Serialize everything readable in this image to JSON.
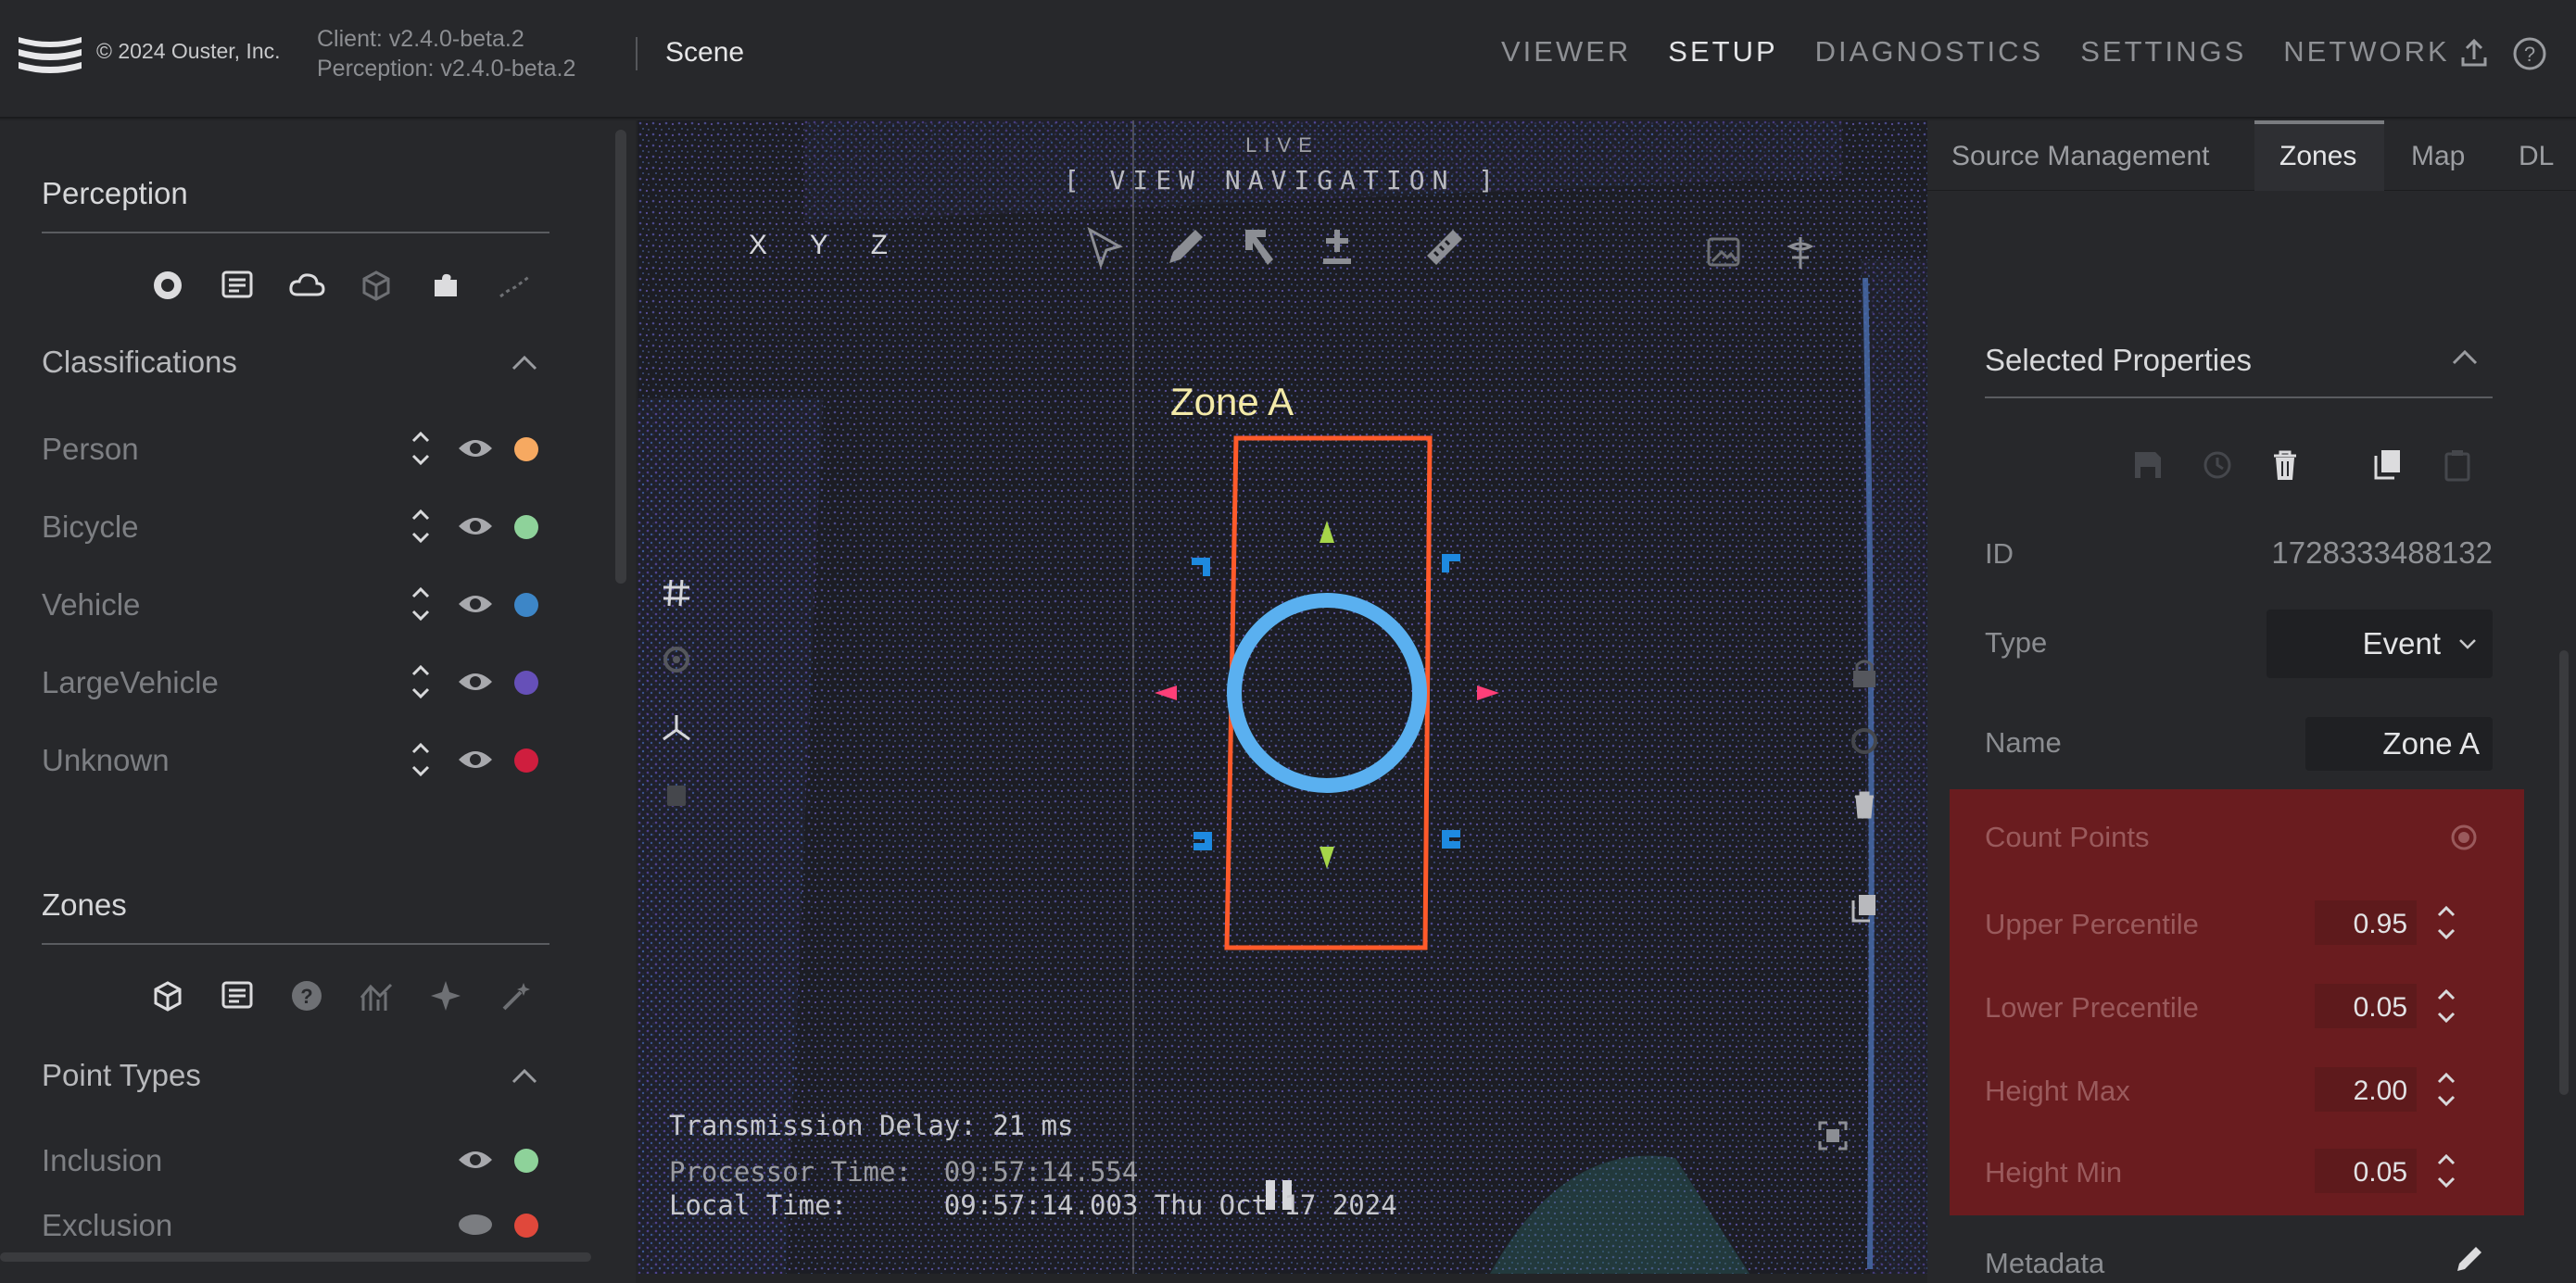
{
  "topbar": {
    "copyright": "© 2024 Ouster, Inc.",
    "client_version": "Client: v2.4.0-beta.2",
    "perception_version": "Perception: v2.4.0-beta.2",
    "scene_title": "Scene",
    "nav": [
      "VIEWER",
      "SETUP",
      "DIAGNOSTICS",
      "SETTINGS",
      "NETWORK"
    ],
    "active_nav": "SETUP"
  },
  "left": {
    "perception_title": "Perception",
    "classifications_title": "Classifications",
    "classes": [
      {
        "label": "Person",
        "color": "#f6a961"
      },
      {
        "label": "Bicycle",
        "color": "#8ed29a"
      },
      {
        "label": "Vehicle",
        "color": "#3d86c7"
      },
      {
        "label": "LargeVehicle",
        "color": "#6650b8"
      },
      {
        "label": "Unknown",
        "color": "#cf1e3e"
      }
    ],
    "zones_title": "Zones",
    "point_types_title": "Point Types",
    "point_types": [
      {
        "label": "Inclusion",
        "color": "#8ed29a"
      },
      {
        "label": "Exclusion",
        "color": "#e0483b"
      }
    ]
  },
  "viewer": {
    "live": "LIVE",
    "view_nav": "[ VIEW NAVIGATION ]",
    "axes": "X Y Z",
    "zone_label": "Zone A",
    "readout": {
      "delay": "Transmission Delay: 21 ms",
      "processor": "Processor Time:  09:57:14.554",
      "local": "Local Time:      09:57:14.003 Thu Oct 17 2024"
    }
  },
  "right": {
    "tabs": [
      "Source Management",
      "Zones",
      "Map",
      "DL"
    ],
    "active_tab": "Zones",
    "selected_properties": "Selected Properties",
    "id_label": "ID",
    "id_value": "1728333488132",
    "type_label": "Type",
    "type_value": "Event",
    "name_label": "Name",
    "name_value": "Zone A",
    "count_points": "Count Points",
    "upper_percentile_label": "Upper Percentile",
    "upper_percentile": "0.95",
    "lower_percentile_label": "Lower Precentile",
    "lower_percentile": "0.05",
    "height_max_label": "Height Max",
    "height_max": "2.00",
    "height_min_label": "Height Min",
    "height_min": "0.05",
    "metadata_label": "Metadata"
  }
}
